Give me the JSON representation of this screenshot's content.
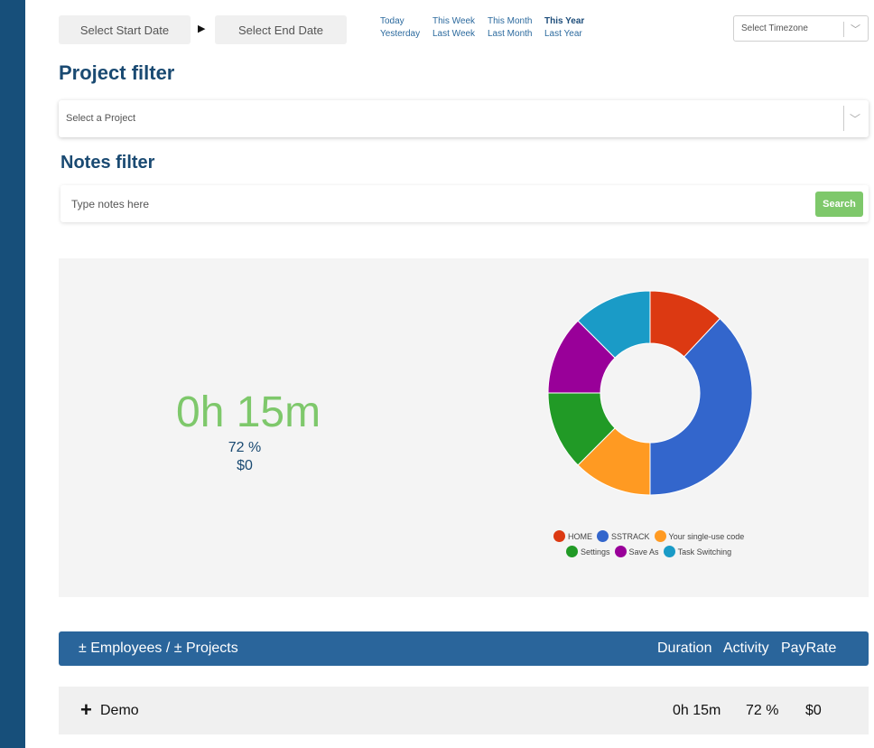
{
  "date_range": {
    "start_label": "Select Start Date",
    "arrow": "▶",
    "end_label": "Select End Date"
  },
  "quick_ranges": {
    "today": "Today",
    "yesterday": "Yesterday",
    "this_week": "This Week",
    "last_week": "Last Week",
    "this_month": "This Month",
    "last_month": "Last Month",
    "this_year": "This Year",
    "last_year": "Last Year",
    "active": "This Year"
  },
  "timezone": {
    "placeholder": "Select Timezone",
    "chevron": "﹀"
  },
  "project_filter": {
    "heading": "Project filter",
    "placeholder": "Select a Project",
    "chevron": "﹀"
  },
  "notes_filter": {
    "heading": "Notes filter",
    "placeholder": "Type notes here",
    "value": "",
    "search_label": "Search"
  },
  "summary": {
    "total_time": "0h 15m",
    "activity": "72 %",
    "pay": "$0"
  },
  "chart_data": {
    "type": "pie",
    "donut": true,
    "categories": [
      "HOME",
      "SSTRACK",
      "Your single-use code",
      "Settings",
      "Save As",
      "Task Switching"
    ],
    "values": [
      12,
      38,
      12.5,
      12.5,
      12.5,
      12.5
    ],
    "colors": [
      "#dc3912",
      "#3366cc",
      "#ff9a22",
      "#219a26",
      "#990099",
      "#1a9bc7"
    ],
    "legend": "bottom"
  },
  "table": {
    "header": {
      "name": "± Employees / ± Projects",
      "duration": "Duration",
      "activity": "Activity",
      "payrate": "PayRate"
    },
    "rows": [
      {
        "expand": "+",
        "name": "Demo",
        "duration": "0h 15m",
        "activity": "72 %",
        "payrate": "$0"
      }
    ]
  }
}
